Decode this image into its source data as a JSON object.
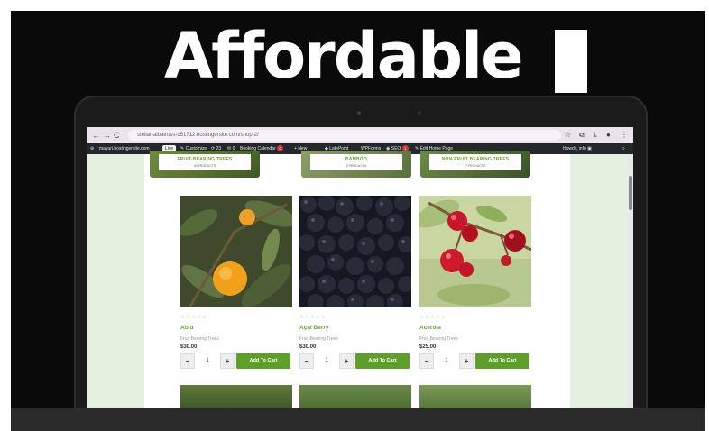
{
  "headline": {
    "text": "Affordable"
  },
  "browser": {
    "url": "stellar-albatross-d51712.hostingersite.com/shop-2/",
    "nav_back": "←",
    "nav_forward": "→",
    "nav_reload": "C"
  },
  "admin_bar": {
    "site": "mayuri.hostingersite.com",
    "live_badge": "Live",
    "customize": "Customize",
    "updates": "23",
    "comments": "0",
    "booking": "Booking Calendar",
    "booking_count": "0",
    "new": "New",
    "lateral": "LatePoint",
    "wpforms": "WPForms",
    "seo": "SEO",
    "seo_count": "1",
    "edit": "Edit Home Page",
    "howdy": "Howdy, info"
  },
  "categories": [
    {
      "title": "FRUIT-BEARING TREES",
      "count": "40 PRODUCTS"
    },
    {
      "title": "BAMBOO",
      "count": "5 PRODUCTS"
    },
    {
      "title": "NON-FRUIT BEARING TREES",
      "count": "7 PRODUCTS"
    }
  ],
  "products": [
    {
      "name": "Abiu",
      "category": "Fruit-Bearing Trees",
      "price": "$30.00",
      "stars": "☆☆☆☆☆",
      "qty": "1",
      "minus": "−",
      "plus": "+",
      "cart": "Add To Cart"
    },
    {
      "name": "Açai Berry",
      "category": "Fruit-Bearing Trees",
      "price": "$30.00",
      "stars": "☆☆☆☆☆",
      "qty": "1",
      "minus": "−",
      "plus": "+",
      "cart": "Add To Cart"
    },
    {
      "name": "Acerola",
      "category": "Fruit-Bearing Trees",
      "price": "$25.00",
      "stars": "☆☆☆☆☆",
      "qty": "1",
      "minus": "−",
      "plus": "+",
      "cart": "Add To Cart"
    }
  ],
  "colors": {
    "accent_green": "#5e9f2c",
    "title_green": "#6ba23a",
    "side_green": "#e4f1e0",
    "admin_bar": "#23282d"
  },
  "icons": [
    "back-icon",
    "forward-icon",
    "reload-icon",
    "star-icon",
    "share-icon",
    "download-icon",
    "profile-icon",
    "menu-icon",
    "wordpress-icon",
    "search-icon"
  ]
}
